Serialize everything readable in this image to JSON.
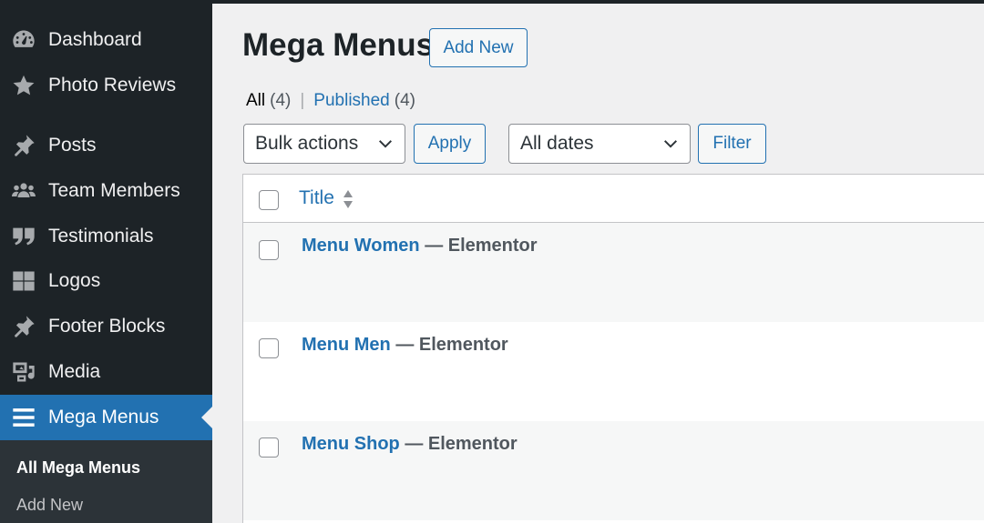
{
  "sidebar": {
    "items": [
      {
        "label": "Dashboard",
        "icon": "dashboard-icon"
      },
      {
        "label": "Photo Reviews",
        "icon": "star-icon"
      },
      {
        "label": "Posts",
        "icon": "pushpin-icon"
      },
      {
        "label": "Team Members",
        "icon": "groups-icon"
      },
      {
        "label": "Testimonials",
        "icon": "quote-icon"
      },
      {
        "label": "Logos",
        "icon": "grid-icon"
      },
      {
        "label": "Footer Blocks",
        "icon": "pushpin-icon"
      },
      {
        "label": "Media",
        "icon": "media-icon"
      },
      {
        "label": "Mega Menus",
        "icon": "menu-icon"
      }
    ],
    "submenu": [
      "All Mega Menus",
      "Add New"
    ]
  },
  "header": {
    "title": "Mega Menus",
    "add_new": "Add New"
  },
  "views": {
    "all_label": "All",
    "all_count": "(4)",
    "separator": "|",
    "published_label": "Published",
    "published_count": "(4)"
  },
  "filters": {
    "bulk_actions": "Bulk actions",
    "apply": "Apply",
    "dates": "All dates",
    "filter": "Filter"
  },
  "table": {
    "column_title": "Title",
    "rows": [
      {
        "name": "Menu Women",
        "state": " — Elementor"
      },
      {
        "name": "Menu Men",
        "state": " — Elementor"
      },
      {
        "name": "Menu Shop",
        "state": " — Elementor"
      }
    ]
  },
  "colors": {
    "sidebar_bg": "#1d2327",
    "accent": "#2271b1",
    "page_bg": "#f0f0f1"
  }
}
